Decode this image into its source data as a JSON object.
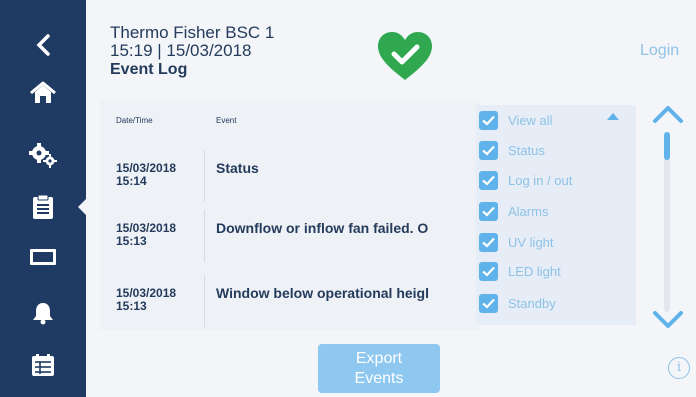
{
  "header": {
    "device_name": "Thermo Fisher BSC 1",
    "datetime": "15:19 | 15/03/2018",
    "page_title": "Event Log",
    "login_label": "Login",
    "status_icon": "heart-check-icon",
    "status_color": "#2fa84f"
  },
  "sidebar": {
    "items": [
      {
        "icon": "back-arrow-icon"
      },
      {
        "icon": "home-icon"
      },
      {
        "icon": "settings-gears-icon"
      },
      {
        "icon": "clipboard-log-icon",
        "active": true
      },
      {
        "icon": "display-screen-icon"
      },
      {
        "icon": "bell-icon"
      },
      {
        "icon": "calendar-icon"
      }
    ]
  },
  "table": {
    "col_datetime": "Date/Time",
    "col_event": "Event",
    "rows": [
      {
        "date": "15/03/2018",
        "time": "15:14",
        "event": "Status"
      },
      {
        "date": "15/03/2018",
        "time": "15:13",
        "event": "Downflow or inflow fan failed. O"
      },
      {
        "date": "15/03/2018",
        "time": "15:13",
        "event": "Window below operational heigl"
      }
    ]
  },
  "filter": {
    "items": [
      {
        "label": "View all",
        "checked": true
      },
      {
        "label": "Status",
        "checked": true
      },
      {
        "label": "Log in / out",
        "checked": true
      },
      {
        "label": "Alarms",
        "checked": true
      },
      {
        "label": "UV light",
        "checked": true
      },
      {
        "label": "LED light",
        "checked": true
      },
      {
        "label": "Standby",
        "checked": true
      }
    ]
  },
  "export_button": {
    "line1": "Export",
    "line2": "Events"
  },
  "colors": {
    "sidebar": "#1f3b63",
    "accent": "#5fb3ea",
    "text": "#243b5c"
  }
}
